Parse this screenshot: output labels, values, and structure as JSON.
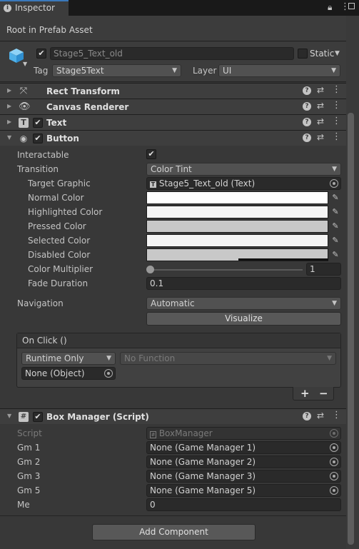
{
  "tab": {
    "label": "Inspector",
    "info_icon": "i"
  },
  "header": {
    "prefab_label": "Root in Prefab Asset",
    "object_name": "Stage5_Text_old",
    "static_label": "Static",
    "tag_label": "Tag",
    "tag_value": "Stage5Text",
    "layer_label": "Layer",
    "layer_value": "UI"
  },
  "components": {
    "rect_transform": "Rect Transform",
    "canvas_renderer": "Canvas Renderer",
    "text": "Text",
    "button": "Button",
    "box_manager": "Box Manager (Script)"
  },
  "button": {
    "interactable_label": "Interactable",
    "transition_label": "Transition",
    "transition_value": "Color Tint",
    "target_graphic_label": "Target Graphic",
    "target_graphic_value": "Stage5_Text_old (Text)",
    "normal_color_label": "Normal Color",
    "highlighted_color_label": "Highlighted Color",
    "pressed_color_label": "Pressed Color",
    "selected_color_label": "Selected Color",
    "disabled_color_label": "Disabled Color",
    "color_multiplier_label": "Color Multiplier",
    "color_multiplier_value": "1",
    "fade_duration_label": "Fade Duration",
    "fade_duration_value": "0.1",
    "navigation_label": "Navigation",
    "navigation_value": "Automatic",
    "visualize_label": "Visualize",
    "onclick_label": "On Click ()",
    "runtime_value": "Runtime Only",
    "function_value": "No Function",
    "object_value": "None (Object)",
    "plus_label": "+",
    "minus_label": "−"
  },
  "box_manager": {
    "script_label": "Script",
    "script_value": "BoxManager",
    "gm1_label": "Gm 1",
    "gm1_value": "None (Game Manager 1)",
    "gm2_label": "Gm 2",
    "gm2_value": "None (Game Manager 2)",
    "gm3_label": "Gm 3",
    "gm3_value": "None (Game Manager 3)",
    "gm5_label": "Gm 5",
    "gm5_value": "None (Game Manager 5)",
    "me_label": "Me",
    "me_value": "0"
  },
  "add_component_label": "Add Component",
  "colors": {
    "normal": "#FFFFFF",
    "highlighted": "#F5F5F5",
    "pressed": "#C8C8C8",
    "selected": "#F5F5F5",
    "disabled": "#C8C8C8",
    "accent": "#3A79BB"
  },
  "color_multiplier_slider": {
    "min": 1,
    "max": 5,
    "value": 1
  }
}
